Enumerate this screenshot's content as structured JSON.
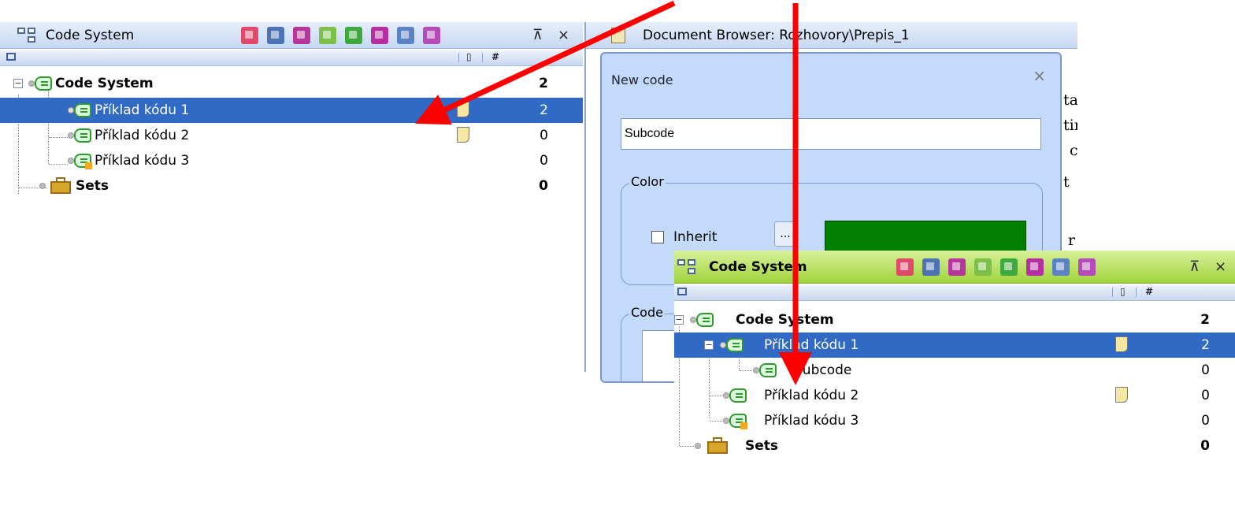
{
  "left_panel": {
    "title": "Code System",
    "close": "×",
    "pin": "⊼",
    "column_memo": "▯",
    "column_count": "#",
    "rows": [
      {
        "label": "Code System",
        "count": "2"
      },
      {
        "label": "Příklad kódu 1",
        "count": "2"
      },
      {
        "label": "Příklad kódu 2",
        "count": "0"
      },
      {
        "label": "Příklad kódu 3",
        "count": "0"
      },
      {
        "label": "Sets",
        "count": "0"
      }
    ]
  },
  "doc_browser": {
    "title": "Document Browser: Rozhovory\\Prepis_1",
    "fragments": [
      "ta",
      "tir",
      "c",
      "t",
      "r"
    ]
  },
  "dialog": {
    "title": "New code",
    "close": "×",
    "name_value": "Subcode",
    "color_group": "Color",
    "inherit_label": "Inherit",
    "browse": "...",
    "swatch_color": "#007f00",
    "code_group": "Code"
  },
  "right_panel": {
    "title": "Code System",
    "close": "×",
    "pin": "⊼",
    "column_memo": "▯",
    "column_count": "#",
    "rows": [
      {
        "label": "Code System",
        "count": "2"
      },
      {
        "label": "Příklad kódu 1",
        "count": "2"
      },
      {
        "label": "Subcode",
        "count": "0"
      },
      {
        "label": "Příklad kódu 2",
        "count": "0"
      },
      {
        "label": "Příklad kódu 3",
        "count": "0"
      },
      {
        "label": "Sets",
        "count": "0"
      }
    ]
  },
  "colors": {
    "selection": "#316ac5",
    "arrow": "#ff0000",
    "green_titlebar": "#9fd23c"
  }
}
